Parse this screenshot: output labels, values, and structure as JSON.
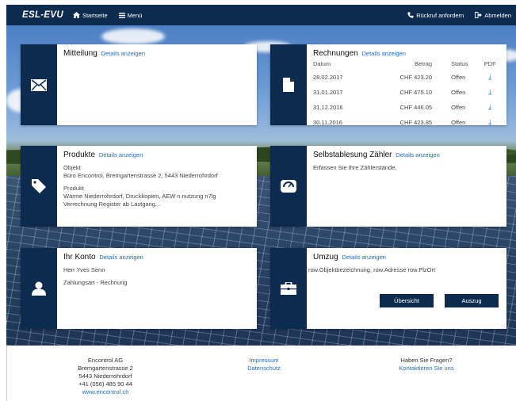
{
  "nav": {
    "logo": "ESL-EVU",
    "home": "Startseite",
    "menu": "Menü",
    "callback": "Rückruf anfordern",
    "logout": "Abmelden"
  },
  "details_label": "Details anzeigen",
  "mitteilung": {
    "title": "Mitteilung"
  },
  "rechnungen": {
    "title": "Rechnungen",
    "headers": {
      "datum": "Datum",
      "betrag": "Betrag",
      "status": "Status",
      "pdf": "PDF"
    },
    "rows": [
      {
        "datum": "28.02.2017",
        "betrag": "CHF 423.20",
        "status": "Offen"
      },
      {
        "datum": "31.01.2017",
        "betrag": "CHF 475.10",
        "status": "Offen"
      },
      {
        "datum": "31.12.2016",
        "betrag": "CHF 446.05",
        "status": "Offen"
      },
      {
        "datum": "30.11.2016",
        "betrag": "CHF 423.85",
        "status": "Offen"
      }
    ]
  },
  "produkte": {
    "title": "Produkte",
    "objekt_label": "Objekt",
    "objekt_value": "Büro Encontrol, Bremgartenstrasse 2, 5443 Niederrohrdorf",
    "produkt_label": "Produkt",
    "produkt_value_1": "Wärme Niederrohrdorf, Druckkopien, AEW n.nutzung n7lg",
    "produkt_value_2": "Verrechnung Register ab Lastgang..."
  },
  "zaehler": {
    "title": "Selbstablesung Zähler",
    "text": "Erfassen Sie Ihre Zählerstände."
  },
  "konto": {
    "title": "Ihr Konto",
    "name": "Herr Yves Senn",
    "zahlungsart": "Zahlungsart - Rechnung"
  },
  "umzug": {
    "title": "Umzug",
    "text": "row.Objektbezeichnung, row.Adresse row.PlzOrt",
    "btn_overview": "Übersicht",
    "btn_auszug": "Auszug"
  },
  "footer": {
    "company": "Encontrol AG",
    "street": "Bremgartenstrasse 2",
    "city": "5443 Niederrohrdorf",
    "phone": "+41 (056) 485 90 44",
    "web": "www.encontrol.ch",
    "impressum": "Impressum",
    "datenschutz": "Datenschutz",
    "questions": "Haben Sie Fragen?",
    "contact": "Kontaktieren Sie uns"
  }
}
